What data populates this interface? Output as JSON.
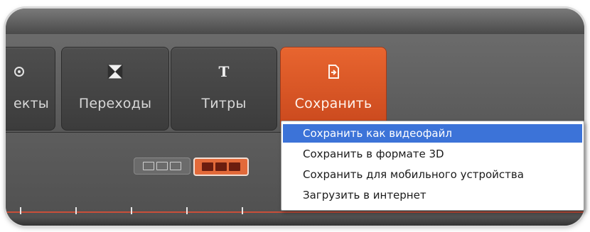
{
  "toolbar": {
    "effects_label": "екты",
    "transitions_label": "Переходы",
    "titles_label": "Титры",
    "save_label": "Сохранить"
  },
  "save_menu": {
    "items": [
      {
        "label": "Сохранить как видеофайл",
        "selected": true
      },
      {
        "label": "Сохранить в формате 3D",
        "selected": false
      },
      {
        "label": "Сохранить для мобильного устройства",
        "selected": false
      },
      {
        "label": "Загрузить в интернет",
        "selected": false
      }
    ]
  },
  "colors": {
    "accent": "#D9552A",
    "menu_highlight": "#3C73D8",
    "panel_bg": "#5B5B5B"
  },
  "icons": {
    "effects": "effects-icon",
    "transitions": "transition-icon",
    "titles": "title-t-icon",
    "save": "save-export-icon",
    "storyboard": "storyboard-view-icon",
    "timeline": "timeline-view-icon"
  }
}
